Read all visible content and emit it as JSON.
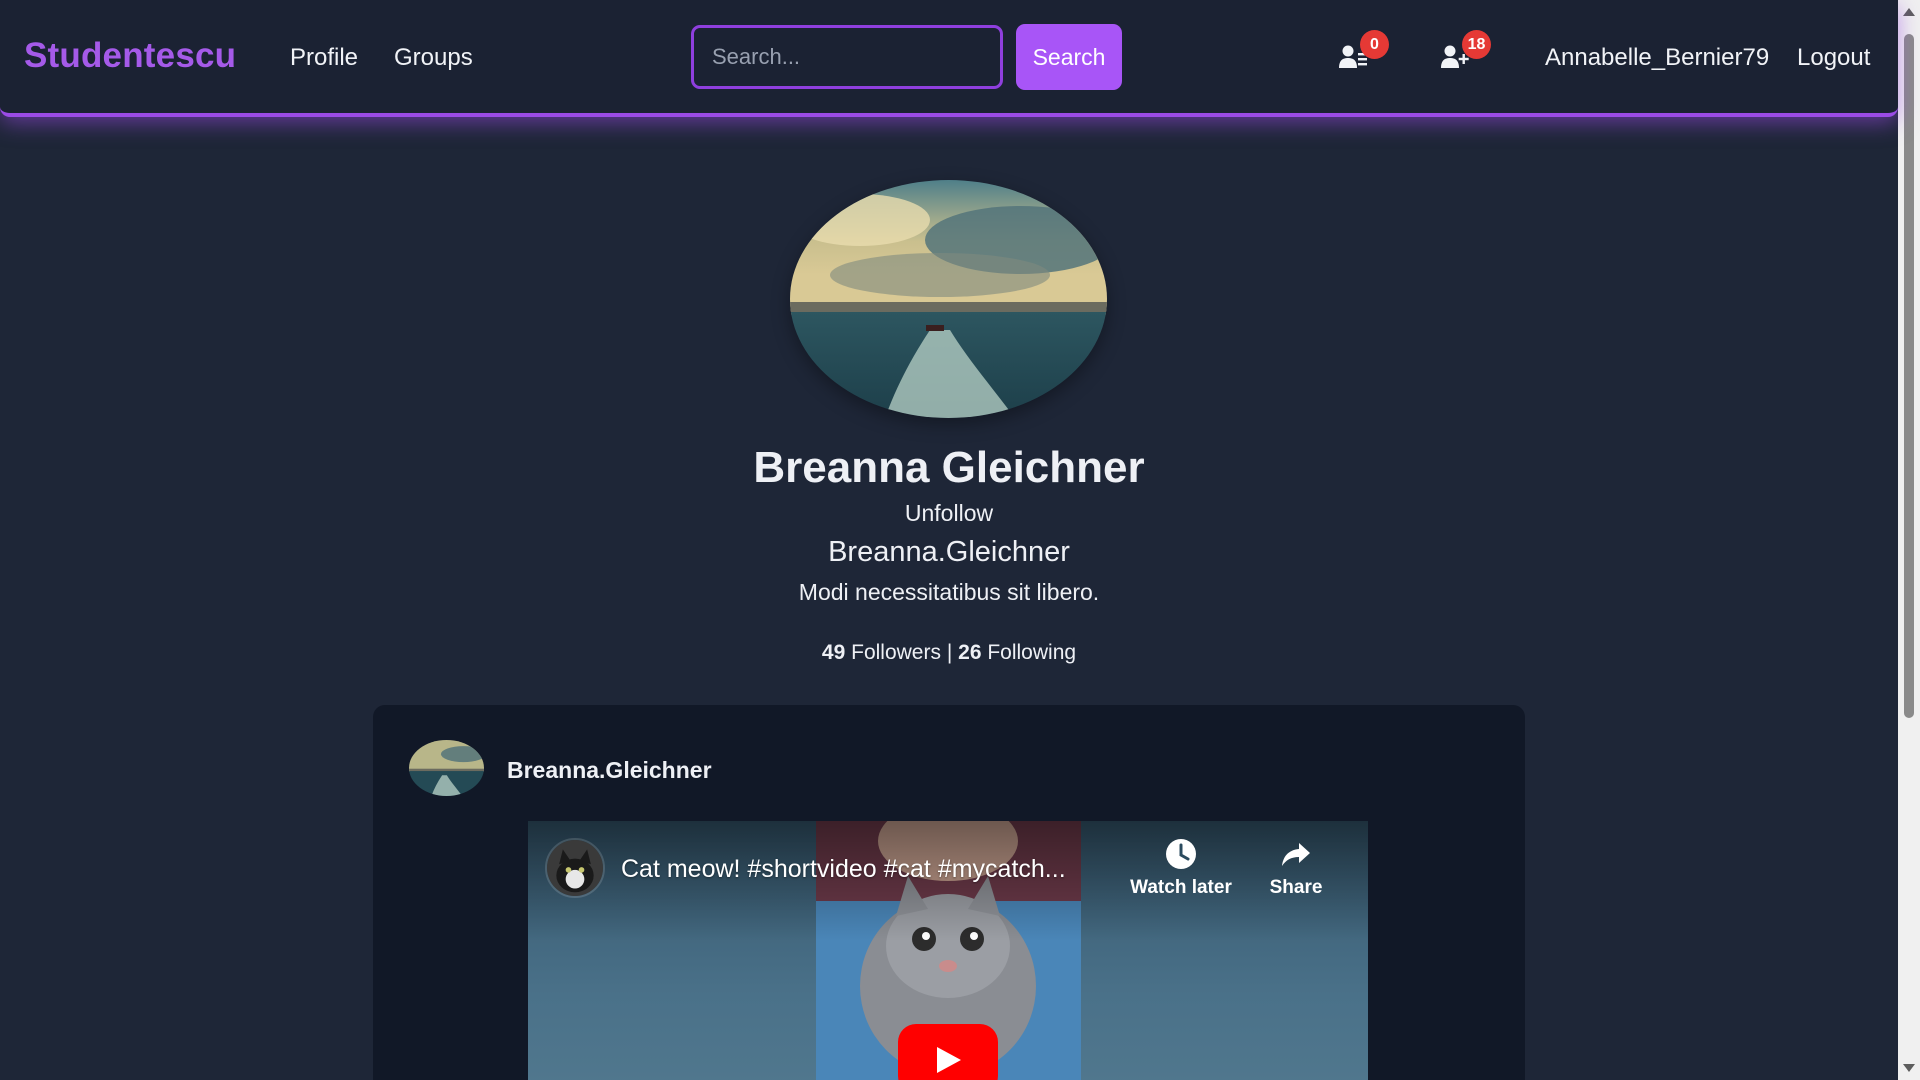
{
  "navbar": {
    "brand": "Studentescu",
    "links": {
      "profile": "Profile",
      "groups": "Groups"
    },
    "search": {
      "placeholder": "Search...",
      "button_label": "Search"
    },
    "notifications": {
      "requests_icon": "user-list-icon",
      "requests_count": "0",
      "follow_icon": "user-plus-icon",
      "follow_count": "18"
    },
    "username": "Annabelle_Bernier79",
    "logout": "Logout"
  },
  "profile": {
    "avatar_icon": "profile-photo",
    "name": "Breanna Gleichner",
    "unfollow_label": "Unfollow",
    "username": "Breanna.Gleichner",
    "bio": "Modi necessitatibus sit libero.",
    "followers_count": "49",
    "followers_label": "Followers",
    "separator": "|",
    "following_count": "26",
    "following_label": "Following"
  },
  "post": {
    "author": "Breanna.Gleichner",
    "video": {
      "title": "Cat meow! #shortvideo #cat #mycatch...",
      "watch_later": "Watch later",
      "share": "Share",
      "play_icon": "play-icon"
    }
  },
  "colors": {
    "accent": "#a855f7",
    "brand": "#a55ae9",
    "background": "#1e2637",
    "navbar": "#1b2233",
    "card": "#111827",
    "badge": "#e53935",
    "play": "#ff0000"
  }
}
